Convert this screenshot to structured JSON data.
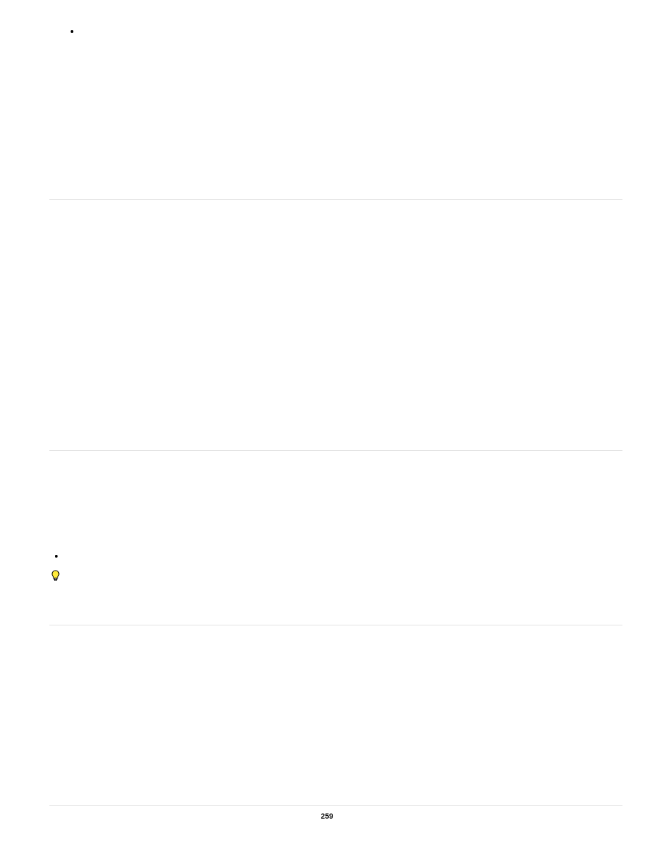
{
  "page": {
    "number": "259"
  }
}
